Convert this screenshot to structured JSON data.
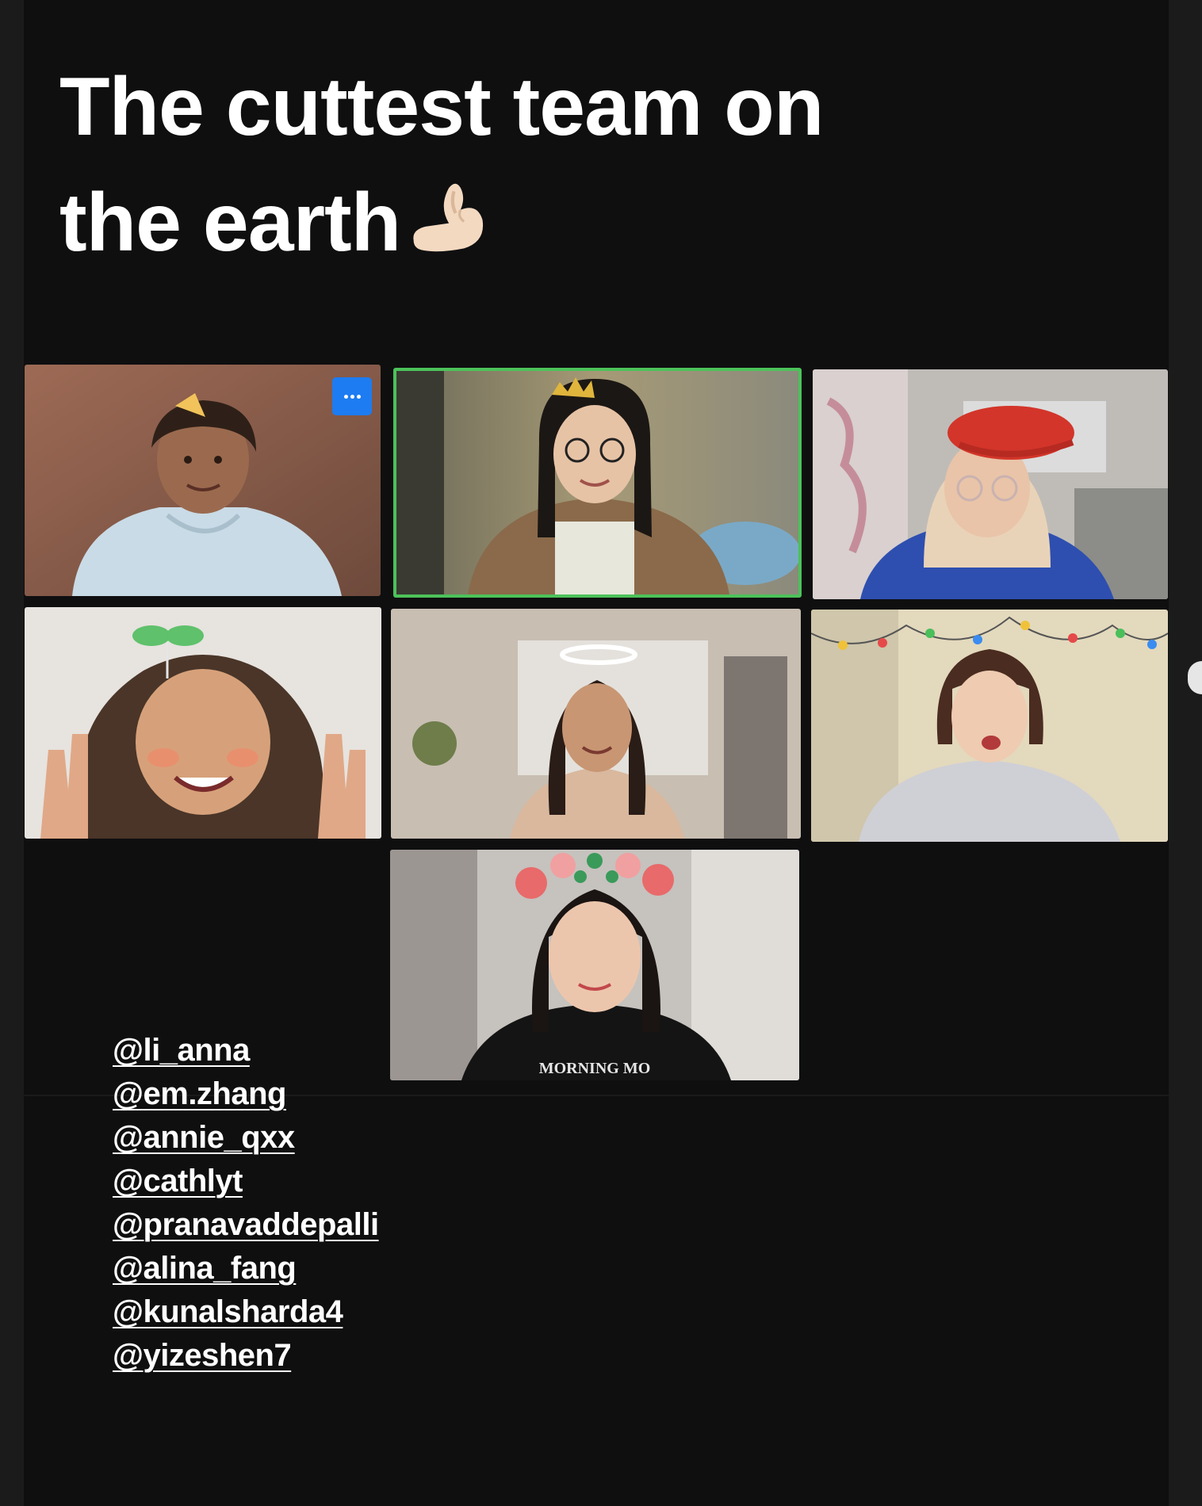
{
  "story": {
    "caption_line1": "The cuttest team on",
    "caption_line2": "the earth"
  },
  "caption_emoji": "pinching-hand-emoji",
  "participants": [
    {
      "tile": "top-left",
      "effect": "pizza-slice-hat",
      "active": false
    },
    {
      "tile": "top-center",
      "effect": "gold-crown",
      "active": true
    },
    {
      "tile": "top-right",
      "effect": "red-beret",
      "active": false
    },
    {
      "tile": "middle-left",
      "effect": "sprout",
      "active": false
    },
    {
      "tile": "middle-center",
      "effect": "halo",
      "active": false
    },
    {
      "tile": "middle-right",
      "effect": "string-lights",
      "active": false
    },
    {
      "tile": "bottom-center",
      "effect": "flower-crown",
      "active": false
    }
  ],
  "hoodie_print": "MORNING MO",
  "more_button_icon": "more-options-icon",
  "tags": [
    "@li_anna",
    "@em.zhang",
    "@annie_qxx",
    "@cathlyt",
    "@pranavaddepalli",
    "@alina_fang",
    "@kunalsharda4",
    "@yizeshen7"
  ],
  "colors": {
    "background": "#0f0f10",
    "active_speaker_border": "#4cc25a",
    "more_button": "#1d7cf2",
    "text": "#ffffff"
  }
}
